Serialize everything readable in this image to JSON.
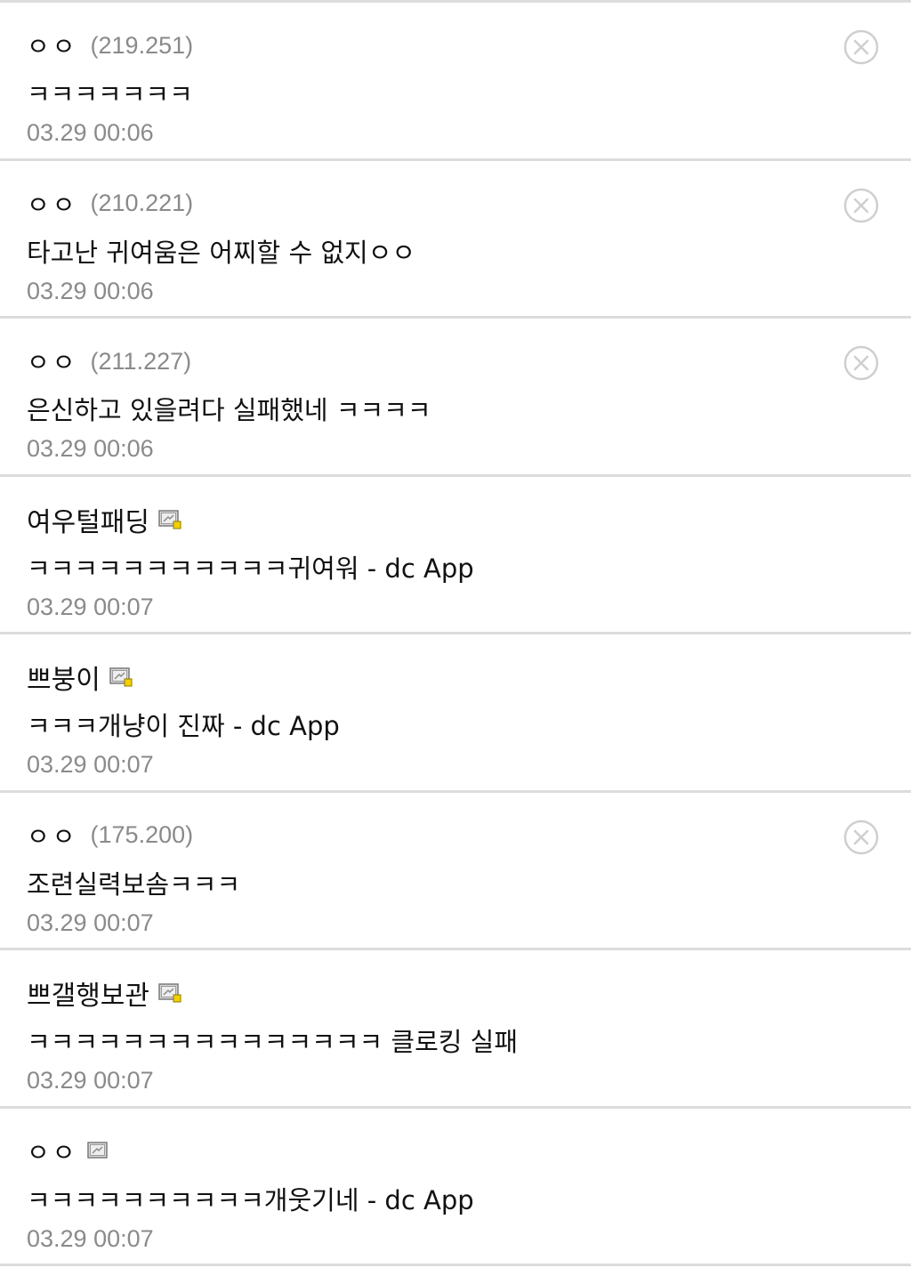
{
  "comments": [
    {
      "nickname": "ㅇㅇ",
      "ip": "(219.251)",
      "text": "ㅋㅋㅋㅋㅋㅋㅋ",
      "time": "03.29 00:06",
      "member": false
    },
    {
      "nickname": "ㅇㅇ",
      "ip": "(210.221)",
      "text": "타고난 귀여움은 어찌할 수 없지ㅇㅇ",
      "time": "03.29 00:06",
      "member": false
    },
    {
      "nickname": "ㅇㅇ",
      "ip": "(211.227)",
      "text": "은신하고 있을려다 실패했네 ㅋㅋㅋㅋ",
      "time": "03.29 00:06",
      "member": false
    },
    {
      "nickname": "여우털패딩",
      "ip": "",
      "text": "ㅋㅋㅋㅋㅋㅋㅋㅋㅋㅋㅋ귀여워 - dc App",
      "time": "03.29 00:07",
      "member": true
    },
    {
      "nickname": "쁘붕이",
      "ip": "",
      "text": "ㅋㅋㅋ개냥이 진짜 - dc App",
      "time": "03.29 00:07",
      "member": true
    },
    {
      "nickname": "ㅇㅇ",
      "ip": "(175.200)",
      "text": "조련실력보솜ㅋㅋㅋ",
      "time": "03.29 00:07",
      "member": false
    },
    {
      "nickname": "쁘갤행보관",
      "ip": "",
      "text": "ㅋㅋㅋㅋㅋㅋㅋㅋㅋㅋㅋㅋㅋㅋㅋ 클로킹 실패",
      "time": "03.29 00:07",
      "member": true
    },
    {
      "nickname": "ㅇㅇ",
      "ip": "",
      "text": "ㅋㅋㅋㅋㅋㅋㅋㅋㅋㅋ개웃기네 - dc App",
      "time": "03.29 00:07",
      "member": true,
      "badge_plain": true
    }
  ],
  "icons": {
    "delete": "close-circle-icon",
    "member_badge": "fixed-nick-icon"
  },
  "colors": {
    "divider": "#dcdcdc",
    "meta_text": "#8a8a8a",
    "badge_accent": "#f5d000"
  }
}
